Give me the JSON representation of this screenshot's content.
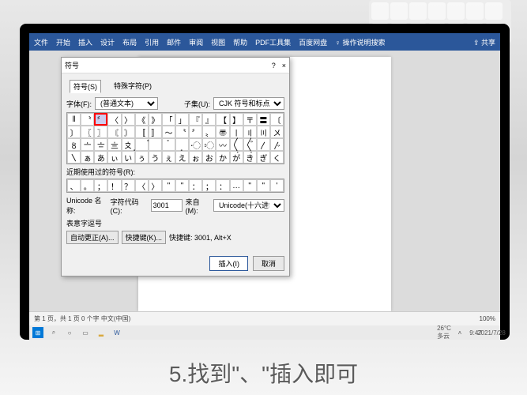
{
  "ribbon": {
    "items": [
      "文件",
      "开始",
      "插入",
      "设计",
      "布局",
      "引用",
      "邮件",
      "审阅",
      "视图",
      "帮助",
      "PDF工具集",
      "百度网盘"
    ],
    "search_hint": "操作说明搜索",
    "share": "共享"
  },
  "dialog": {
    "title": "符号",
    "tabs": [
      "符号(S)",
      "特殊字符(P)"
    ],
    "font_label": "字体(F):",
    "font_value": "(普通文本)",
    "subset_label": "子集(U):",
    "subset_value": "CJK 符号和标点",
    "recent_label": "近期使用过的符号(R):",
    "unicode_name": "Unicode 名称:",
    "unicode_value": "表意字逗号",
    "code_label": "字符代码(C):",
    "code_value": "3001",
    "from_label": "来自(M):",
    "from_value": "Unicode(十六进制)",
    "autocorrect": "自动更正(A)...",
    "shortcut": "快捷键(K)...",
    "shortcut_value": "快捷键: 3001, Alt+X",
    "insert": "插入(I)",
    "cancel": "取消"
  },
  "symbols": [
    "‖",
    "〝",
    "〞",
    "〈",
    "〉",
    "《",
    "》",
    "「",
    "」",
    "『",
    "』",
    "【",
    "】",
    "〒",
    "〓",
    "〔",
    "〕",
    "〖",
    "〗",
    "〘",
    "〙",
    "〚",
    "〛",
    "〜",
    "〝",
    "〞",
    "〟",
    "〠",
    "〡",
    "〢",
    "〣",
    "〤",
    "〥",
    "〦",
    "〧",
    "〨",
    "〩",
    "〪",
    "〫",
    "〬",
    "〭",
    "〮",
    "〯",
    "〰",
    "〱",
    "〲",
    "〳",
    "〴",
    "〵",
    "ぁ",
    "あ",
    "ぃ",
    "い",
    "ぅ",
    "う",
    "ぇ",
    "え",
    "ぉ",
    "お",
    "か",
    "が",
    "き",
    "ぎ",
    "く"
  ],
  "selected_index": 2,
  "recent": [
    "、",
    "。",
    "；",
    "！",
    "？",
    "〈",
    "〉",
    "\"",
    "\"",
    "：",
    "；",
    "：",
    "…",
    "\"",
    "\"",
    "'"
  ],
  "statusbar": {
    "left": "第 1 页，共 1 页  0 个字  中文(中国)",
    "zoom": "100%",
    "right": "9:47"
  },
  "taskbar": {
    "weather": "26°C 多云",
    "time": "9:47",
    "date": "2021/7/28"
  },
  "caption": "5.找到\"、\"插入即可"
}
